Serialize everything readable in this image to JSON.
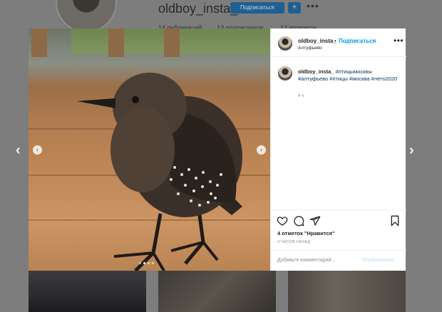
{
  "profile": {
    "username": "oldboy_insta_",
    "follow_label": "Подписаться",
    "plus_label": "+",
    "more_label": "•••",
    "stats": [
      "14 публикаций",
      "13 подписчиков",
      "12 подписок"
    ]
  },
  "nav": {
    "prev": "‹",
    "next": "›"
  },
  "post": {
    "username": "oldboy_insta_",
    "separator": "•",
    "follow_label": "Подписаться",
    "location": "Алтуфьево",
    "more_label": "•••",
    "caption_user": "oldboy_insta_",
    "hashtags": "#птицымосквы #алтуфьево #птицы #москва #лето2020",
    "caption_time": "4 ч.",
    "likes": "4 отметок \"Нравится\"",
    "time_ago": "4 ЧАСОВ НАЗАД",
    "comment_placeholder": "Добавьте комментарий...",
    "publish_label": "Опубликовать",
    "photo_prev": "‹",
    "photo_next": "›",
    "carousel": {
      "count": 4,
      "active_index": 1
    }
  },
  "icons": [
    "heart-icon",
    "comment-icon",
    "share-icon",
    "bookmark-icon",
    "more-icon",
    "chevron-left-icon",
    "chevron-right-icon"
  ],
  "colors": {
    "link": "#0095f6",
    "hashtag": "#00376b",
    "muted": "#8e8e8e",
    "text": "#262626"
  }
}
